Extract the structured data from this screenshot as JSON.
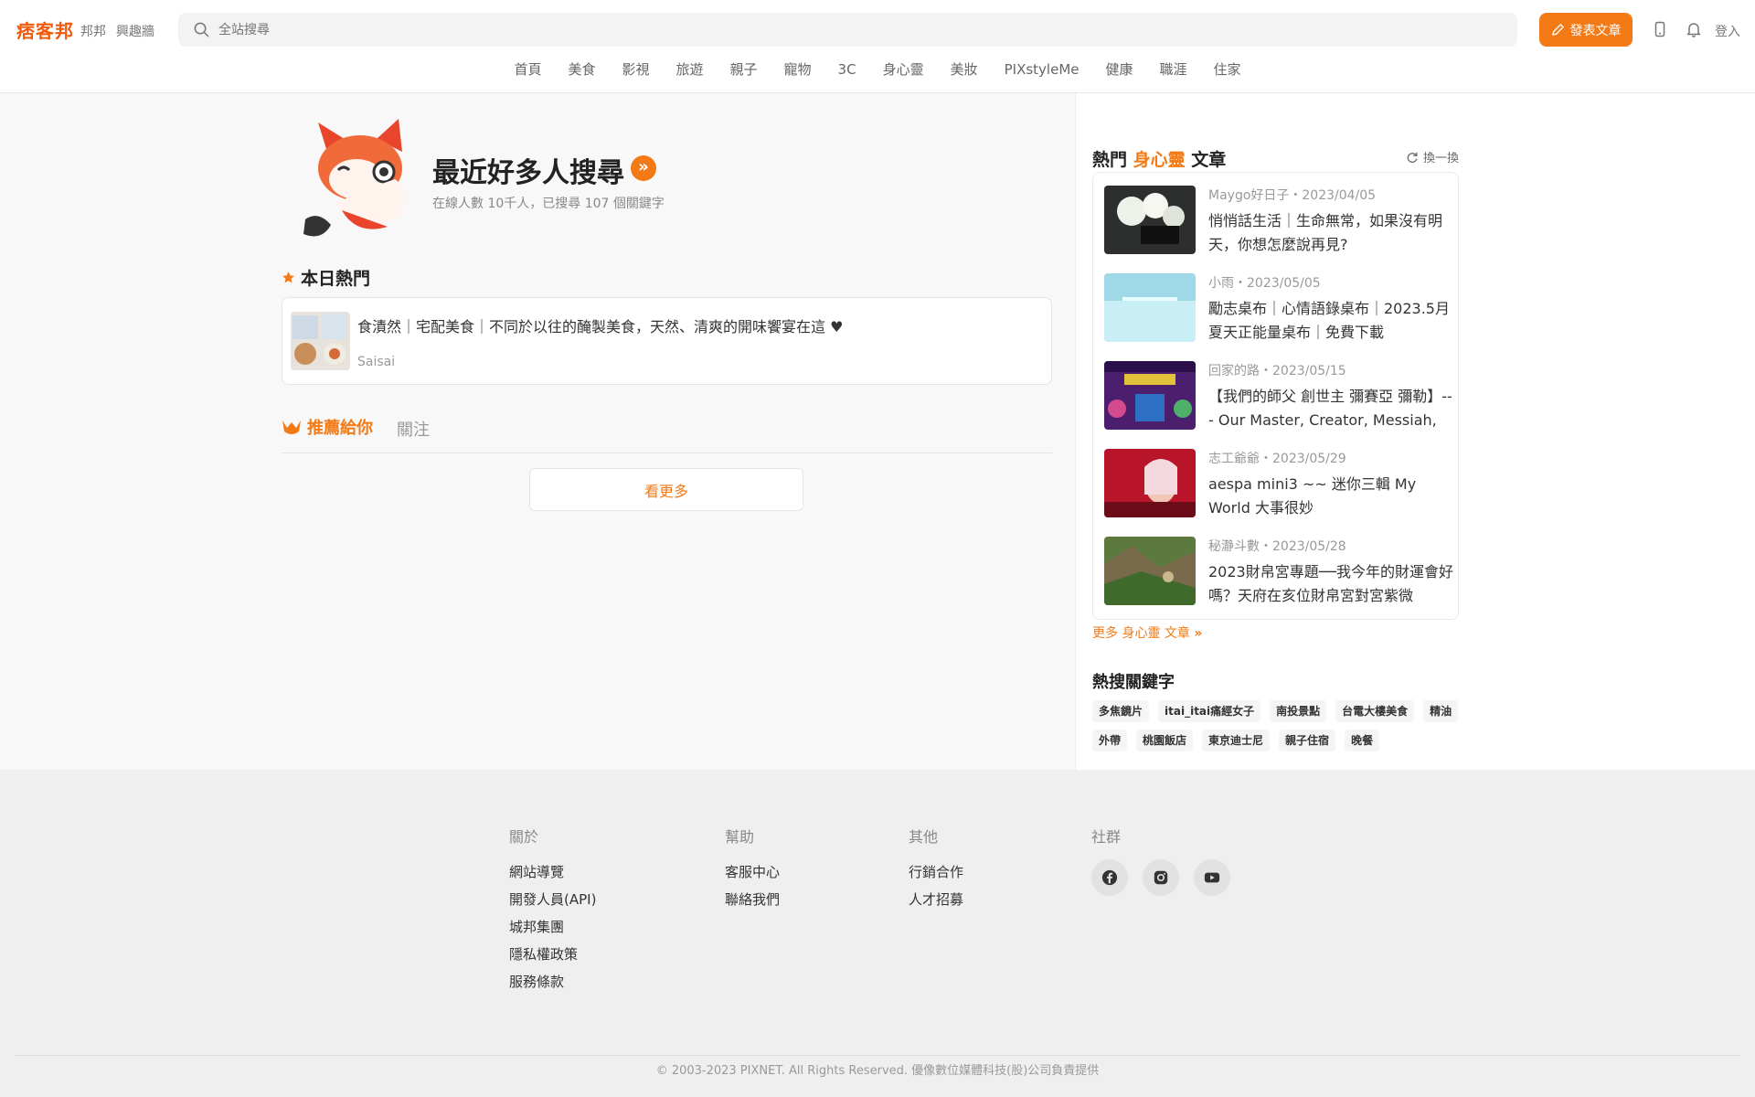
{
  "header": {
    "logo": "痞客邦",
    "links": [
      "邦邦",
      "興趣牆"
    ],
    "search_placeholder": "全站搜尋",
    "post_label": "發表文章",
    "login_label": "登入",
    "accent": "#f47a16"
  },
  "nav": [
    "首頁",
    "美食",
    "影視",
    "旅遊",
    "親子",
    "寵物",
    "3C",
    "身心靈",
    "美妝",
    "PIXstyleMe",
    "健康",
    "職涯",
    "住家"
  ],
  "hero": {
    "title": "最近好多人搜尋",
    "subtitle": "在線人數 10千人，已搜尋 107 個關鍵字"
  },
  "today": {
    "section_title": "本日熱門",
    "article_title": "食漬然｜宅配美食｜不同於以往的醃製美食，天然、清爽的開味饗宴在這 ♥",
    "article_author": "Saisai"
  },
  "tabs": {
    "recommend": "推薦給你",
    "follow": "關注"
  },
  "more_button": "看更多",
  "sidebar": {
    "heading_prefix": "熱門",
    "heading_category": "身心靈",
    "heading_suffix": "文章",
    "refresh_label": "換一換",
    "articles": [
      {
        "meta": "Maygo好日子・2023/04/05",
        "title": "悄悄話生活｜生命無常，如果沒有明天，你想怎麼說再見?"
      },
      {
        "meta": "小雨・2023/05/05",
        "title": "勵志桌布｜心情語錄桌布｜2023.5月夏天正能量桌布｜免費下載"
      },
      {
        "meta": "回家的路・2023/05/15",
        "title": "【我們的師父 創世主 彌賽亞 彌勒】--- Our Master, Creator, Messiah,"
      },
      {
        "meta": "志工爺爺・2023/05/29",
        "title": "aespa mini3 ~~ 迷你三輯 My World 大事很妙"
      },
      {
        "meta": "秘瀞斗數・2023/05/28",
        "title": "2023財帛宮專題──我今年的財運會好嗎？天府在亥位財帛宮對宮紫微"
      }
    ],
    "more_articles": "更多 身心靈 文章",
    "keywords_title": "熱搜關鍵字",
    "keywords": [
      "多焦鏡片",
      "itai_itai痛經女子",
      "南投景點",
      "台電大樓美食",
      "精油",
      "外帶",
      "桃園飯店",
      "東京迪士尼",
      "親子住宿",
      "晚餐"
    ]
  },
  "footer": {
    "about": {
      "title": "關於",
      "links": [
        "網站導覽",
        "開發人員(API)",
        "城邦集團",
        "隱私權政策",
        "服務條款"
      ]
    },
    "help": {
      "title": "幫助",
      "links": [
        "客服中心",
        "聯絡我們"
      ]
    },
    "other": {
      "title": "其他",
      "links": [
        "行銷合作",
        "人才招募"
      ]
    },
    "social": {
      "title": "社群",
      "icons": [
        "facebook-icon",
        "instagram-icon",
        "youtube-icon"
      ]
    },
    "copyright": "© 2003-2023 PIXNET. All Rights Reserved. 優像數位媒體科技(股)公司負責提供"
  }
}
